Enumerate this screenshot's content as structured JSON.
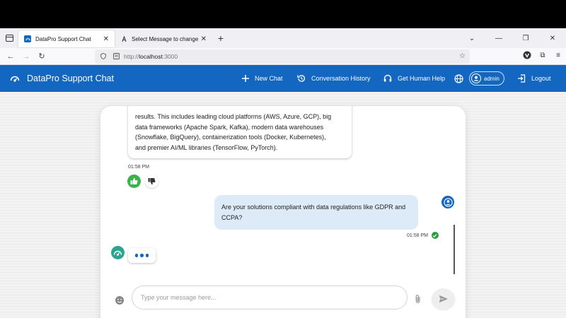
{
  "browser": {
    "tabs": [
      {
        "title": "DataPro Support Chat",
        "active": true
      },
      {
        "title": "Select Message to change | Dat",
        "active": false
      }
    ],
    "url_prefix": "http://",
    "url_host": "localhost",
    "url_suffix": ":3000"
  },
  "header": {
    "brand": "DataPro Support Chat",
    "new_chat": "New Chat",
    "history": "Conversation History",
    "human_help": "Get Human Help",
    "user": "admin",
    "logout": "Logout",
    "color": "#1467c1"
  },
  "chat": {
    "bot_message": {
      "lines": [
        "results. This includes leading cloud platforms (AWS, Azure, GCP), big",
        "data frameworks (Apache Spark, Kafka), modern data warehouses",
        "(Snowflake, BigQuery), containerization tools (Docker, Kubernetes),",
        "and premier AI/ML libraries (TensorFlow, PyTorch)."
      ],
      "time": "01:58 PM"
    },
    "user_message": {
      "lines": [
        "Are your solutions compliant with data regulations like GDPR and",
        "CCPA?"
      ],
      "time": "01:58 PM"
    },
    "input_placeholder": "Type your message here..."
  }
}
